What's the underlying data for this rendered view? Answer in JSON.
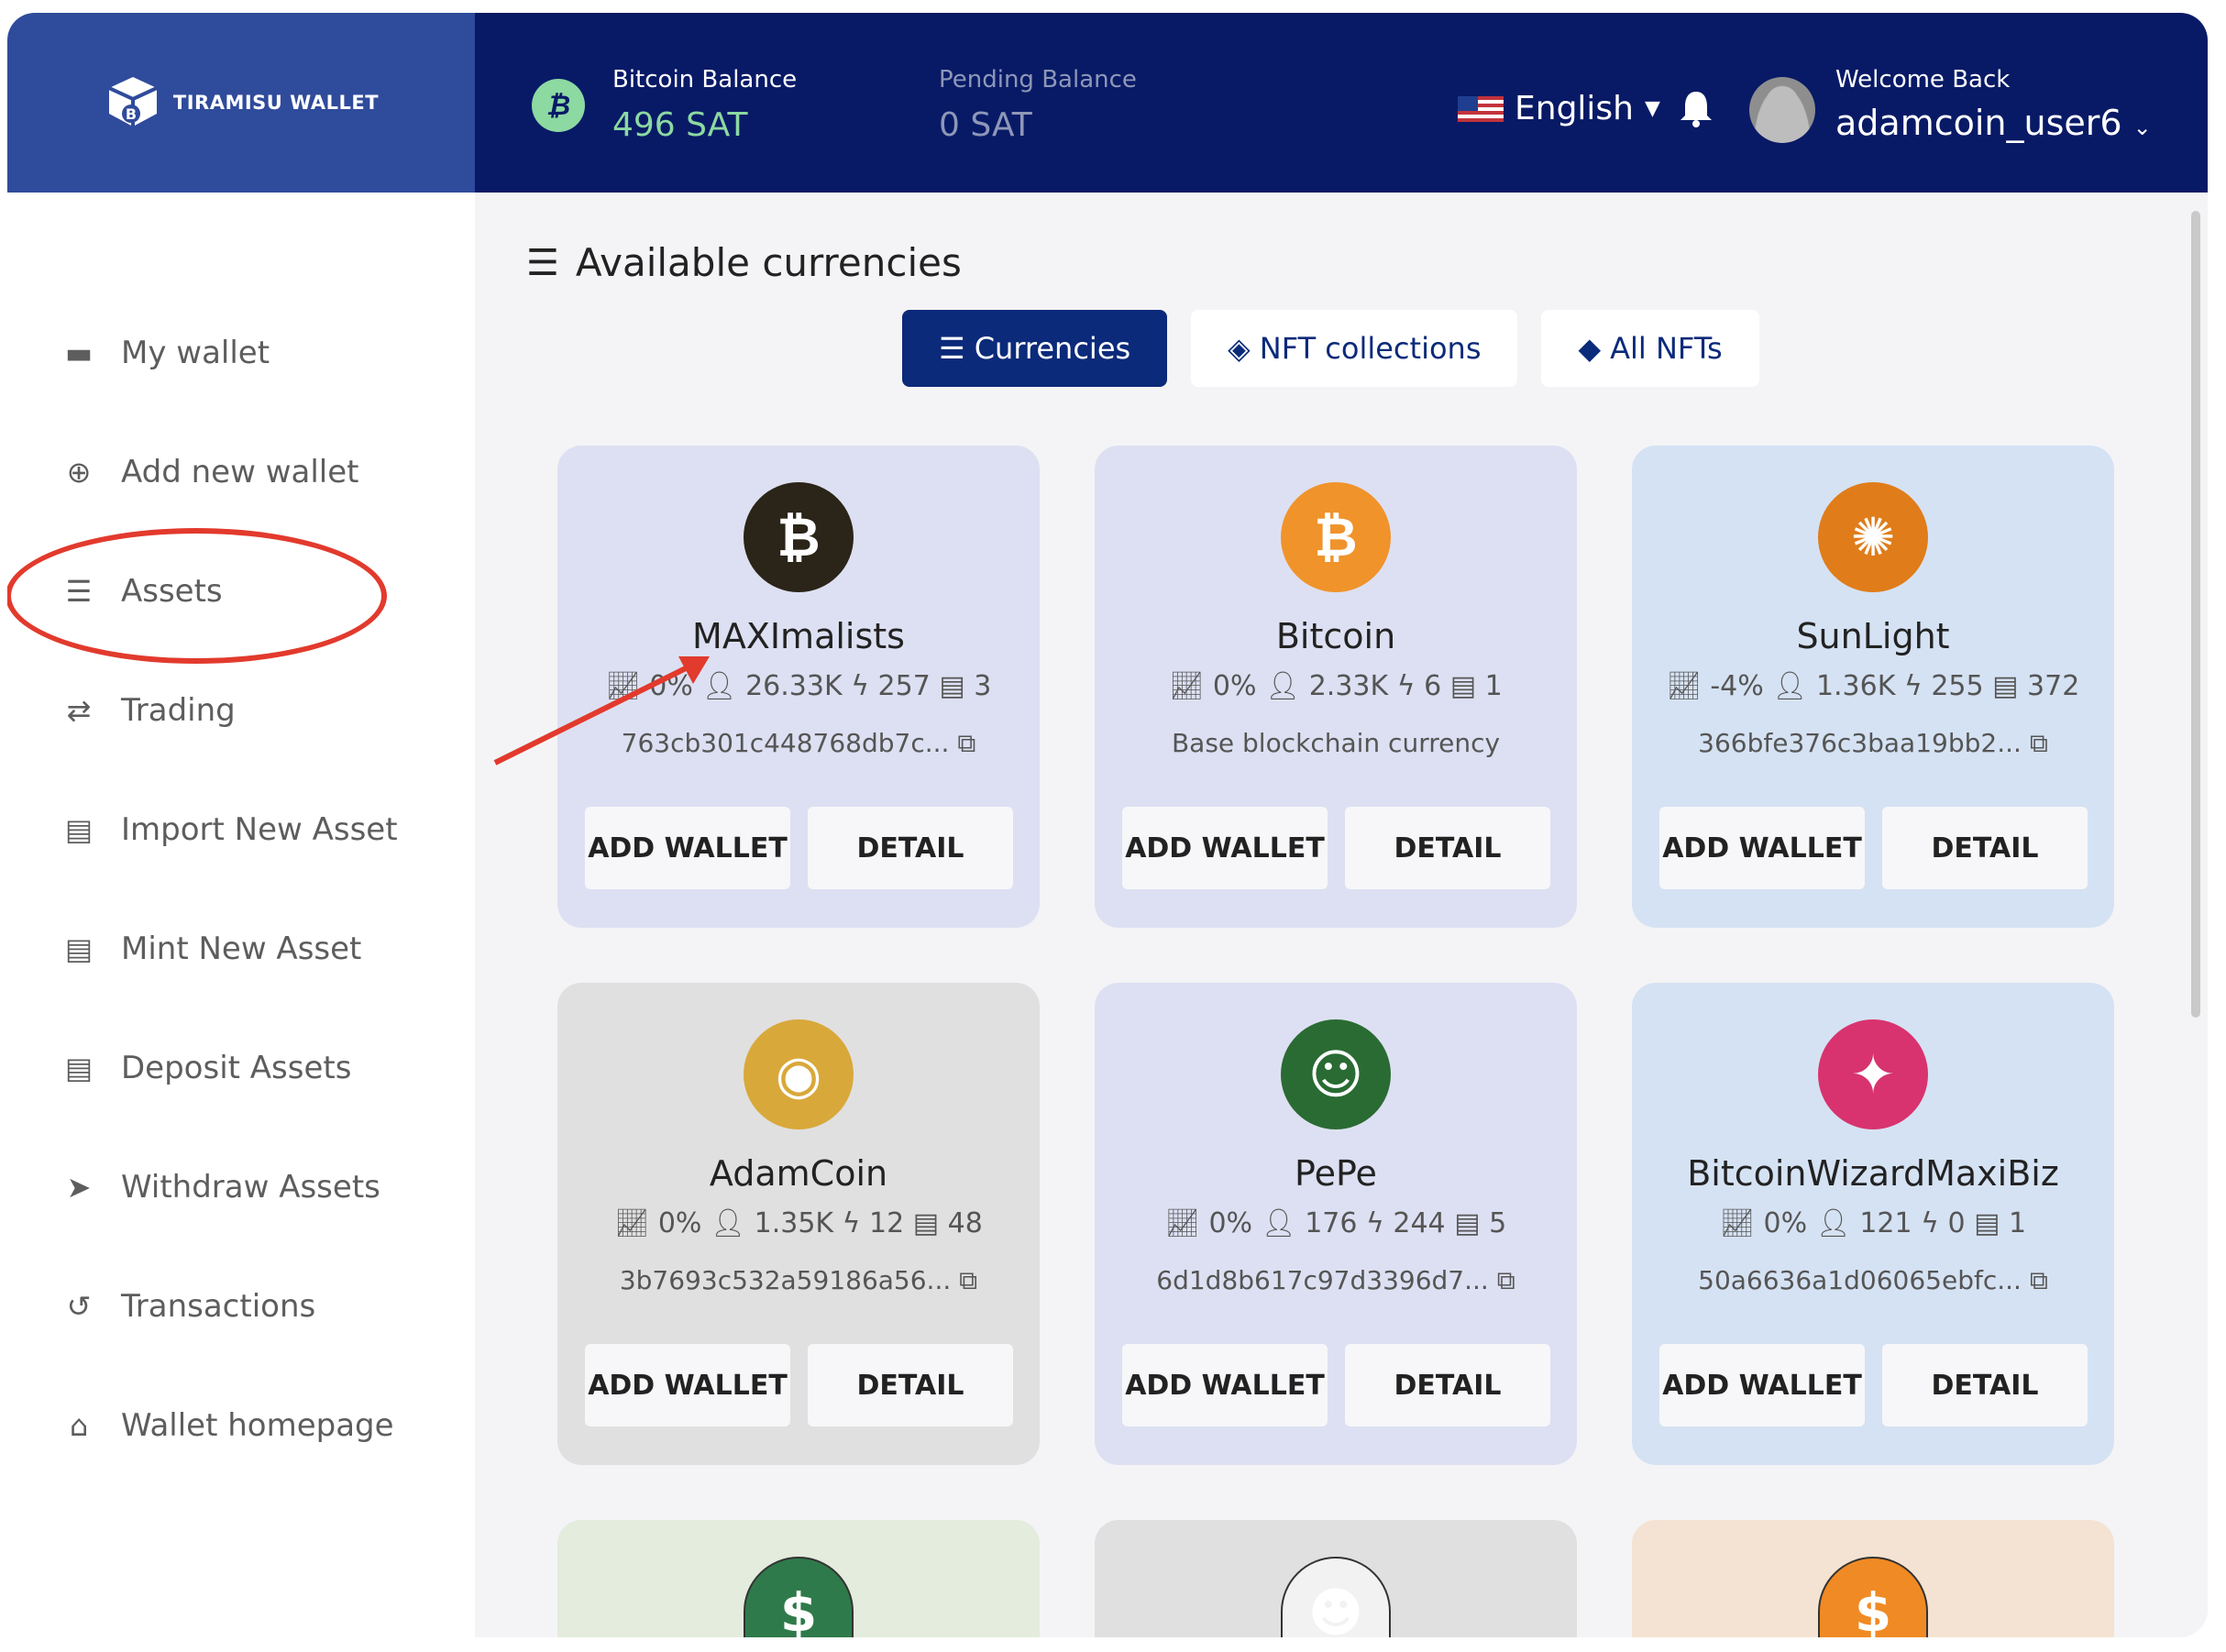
{
  "header": {
    "logo_text": "TIRAMISU WALLET",
    "bitcoin_balance_label": "Bitcoin Balance",
    "bitcoin_balance_value": "496 SAT",
    "pending_balance_label": "Pending Balance",
    "pending_balance_value": "0 SAT",
    "language": "English",
    "welcome_label": "Welcome Back",
    "username": "adamcoin_user6"
  },
  "sidebar": {
    "items": [
      {
        "label": "My wallet",
        "icon": "wallet-icon"
      },
      {
        "label": "Add new wallet",
        "icon": "plus-circle-icon"
      },
      {
        "label": "Assets",
        "icon": "coins-icon"
      },
      {
        "label": "Trading",
        "icon": "exchange-icon"
      },
      {
        "label": "Import New Asset",
        "icon": "file-import-icon"
      },
      {
        "label": "Mint New Asset",
        "icon": "file-upload-icon"
      },
      {
        "label": "Deposit Assets",
        "icon": "file-invoice-dollar-icon"
      },
      {
        "label": "Withdraw Assets",
        "icon": "paper-plane-icon"
      },
      {
        "label": "Transactions",
        "icon": "history-icon"
      },
      {
        "label": "Wallet homepage",
        "icon": "home-icon"
      }
    ]
  },
  "main": {
    "title": "Available currencies",
    "tabs": [
      {
        "label": "Currencies",
        "active": true
      },
      {
        "label": "NFT collections",
        "active": false
      },
      {
        "label": "All NFTs",
        "active": false
      }
    ],
    "add_wallet_label": "ADD WALLET",
    "detail_label": "DETAIL",
    "cards": [
      {
        "name": "MAXImalists",
        "change": "0%",
        "holders": "26.33K",
        "lightning": "257",
        "docs": "3",
        "desc": "763cb301c448768db7c...",
        "bg": "#dde0f2",
        "coin_color": "#2b2418",
        "coin_symbol": "₿"
      },
      {
        "name": "Bitcoin",
        "change": "0%",
        "holders": "2.33K",
        "lightning": "6",
        "docs": "1",
        "desc": "Base blockchain currency",
        "bg": "#dde0f2",
        "coin_color": "#f0932b",
        "coin_symbol": "₿"
      },
      {
        "name": "SunLight",
        "change": "-4%",
        "holders": "1.36K",
        "lightning": "255",
        "docs": "372",
        "desc": "366bfe376c3baa19bb2...",
        "bg": "#d5e2f3",
        "coin_color": "#e07d1a",
        "coin_symbol": "✺"
      },
      {
        "name": "AdamCoin",
        "change": "0%",
        "holders": "1.35K",
        "lightning": "12",
        "docs": "48",
        "desc": "3b7693c532a59186a56...",
        "bg": "#e0e0e0",
        "coin_color": "#d9a83a",
        "coin_symbol": "◉"
      },
      {
        "name": "PePe",
        "change": "0%",
        "holders": "176",
        "lightning": "244",
        "docs": "5",
        "desc": "6d1d8b617c97d3396d7...",
        "bg": "#dde0f2",
        "coin_color": "#2a6b33",
        "coin_symbol": "☺"
      },
      {
        "name": "BitcoinWizardMaxiBiz",
        "change": "0%",
        "holders": "121",
        "lightning": "0",
        "docs": "1",
        "desc": "50a6636a1d06065ebfc...",
        "bg": "#d5e2f3",
        "coin_color": "#d8336e",
        "coin_symbol": "✦"
      }
    ],
    "bottom_cards": [
      {
        "bg": "#e3ecdd",
        "coin_color": "#2f7a4a",
        "coin_symbol": "$"
      },
      {
        "bg": "#e0e0e0",
        "coin_color": "#f2f2f2",
        "coin_symbol": "☻"
      },
      {
        "bg": "#f4e3d2",
        "coin_color": "#f08a24",
        "coin_symbol": "$"
      }
    ]
  }
}
